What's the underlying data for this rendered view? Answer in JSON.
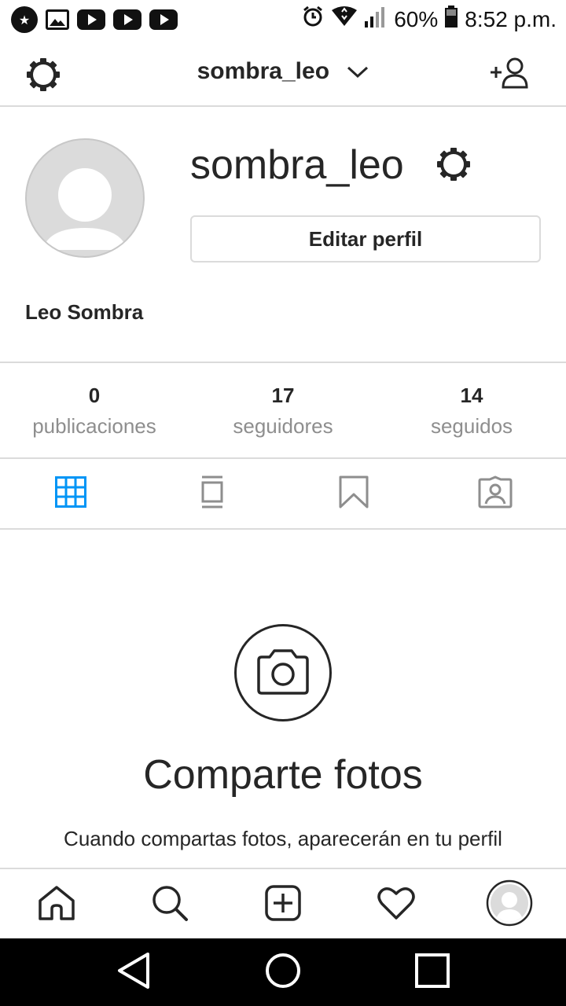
{
  "status_bar": {
    "battery": "60%",
    "time": "8:52 p.m.",
    "left_icons": [
      "star-notification-icon",
      "gallery-icon",
      "youtube-icon",
      "youtube-icon",
      "youtube-icon"
    ],
    "right_icons": [
      "alarm-icon",
      "wifi-icon",
      "signal-icon",
      "battery-icon"
    ]
  },
  "top_bar": {
    "username": "sombra_leo",
    "left_icon": "settings-gear-icon",
    "right_icon": "add-person-icon"
  },
  "profile": {
    "username": "sombra_leo",
    "edit_button": "Editar perfil",
    "full_name": "Leo Sombra"
  },
  "stats": [
    {
      "value": "0",
      "label": "publicaciones"
    },
    {
      "value": "17",
      "label": "seguidores"
    },
    {
      "value": "14",
      "label": "seguidos"
    }
  ],
  "tabs": [
    {
      "icon": "grid-icon",
      "active": true
    },
    {
      "icon": "feed-list-icon",
      "active": false
    },
    {
      "icon": "bookmark-icon",
      "active": false
    },
    {
      "icon": "tagged-person-icon",
      "active": false
    }
  ],
  "empty_state": {
    "title": "Comparte fotos",
    "description": "Cuando compartas fotos, aparecerán en tu perfil"
  },
  "bottom_nav": [
    "home-icon",
    "search-icon",
    "add-post-icon",
    "heart-icon",
    "profile-avatar-icon"
  ],
  "android_nav": [
    "back-icon",
    "home-circle-icon",
    "recents-icon"
  ],
  "colors": {
    "accent": "#0095f6",
    "text": "#262626",
    "secondary": "#8e8e8e",
    "divider": "#dbdbdb"
  }
}
